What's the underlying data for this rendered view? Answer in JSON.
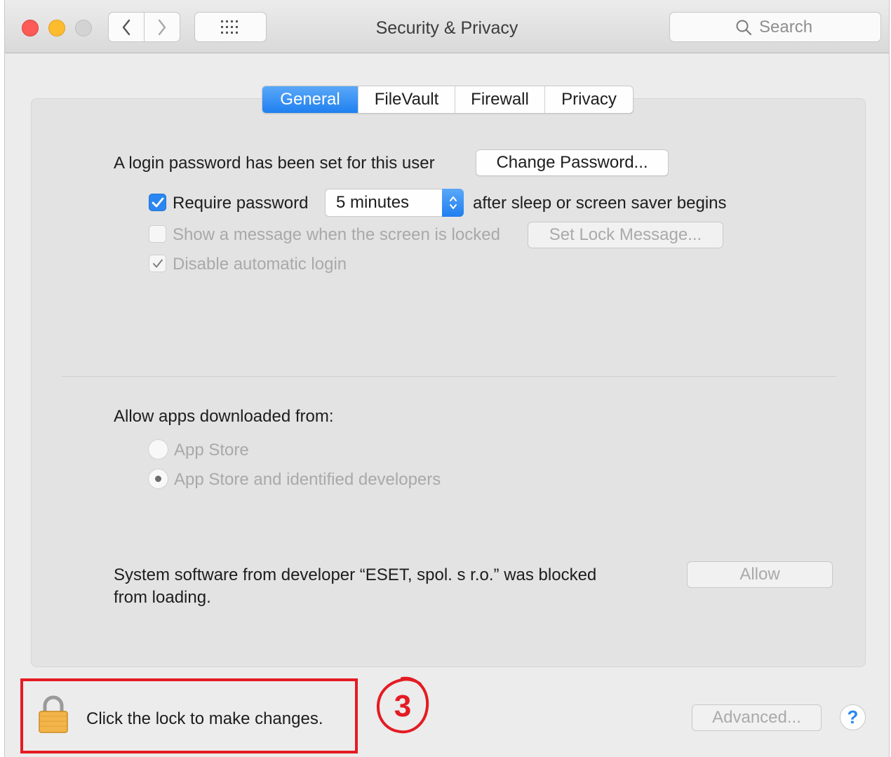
{
  "window": {
    "title": "Security & Privacy"
  },
  "toolbar": {
    "back_icon": "chevron-left-icon",
    "forward_icon": "chevron-right-icon",
    "grid_icon": "show-all-grid-icon",
    "search_placeholder": "Search"
  },
  "tabs": [
    {
      "label": "General",
      "active": true
    },
    {
      "label": "FileVault",
      "active": false
    },
    {
      "label": "Firewall",
      "active": false
    },
    {
      "label": "Privacy",
      "active": false
    }
  ],
  "general": {
    "login_password_text": "A login password has been set for this user",
    "change_password_label": "Change Password...",
    "require_password": {
      "label": "Require password",
      "checked": true
    },
    "require_password_delay": "5 minutes",
    "after_sleep_text": "after sleep or screen saver begins",
    "show_message": {
      "label": "Show a message when the screen is locked",
      "checked": false
    },
    "set_lock_message_label": "Set Lock Message...",
    "disable_auto_login": {
      "label": "Disable automatic login",
      "checked": true
    }
  },
  "allow_apps": {
    "heading": "Allow apps downloaded from:",
    "options": [
      {
        "label": "App Store",
        "selected": false
      },
      {
        "label": "App Store and identified developers",
        "selected": true
      }
    ]
  },
  "blocked": {
    "message_line1": "System software from developer “ESET, spol. s r.o.” was blocked",
    "message_line2": "from loading.",
    "allow_label": "Allow"
  },
  "footer": {
    "lock_text": "Click the lock to make changes.",
    "advanced_label": "Advanced...",
    "help_label": "?"
  },
  "annotation": {
    "step_number": "3",
    "highlight_color": "#e41b23"
  },
  "colors": {
    "accent": "#1f80f0",
    "close": "#fc5b57",
    "minimize": "#fdbb2e"
  }
}
